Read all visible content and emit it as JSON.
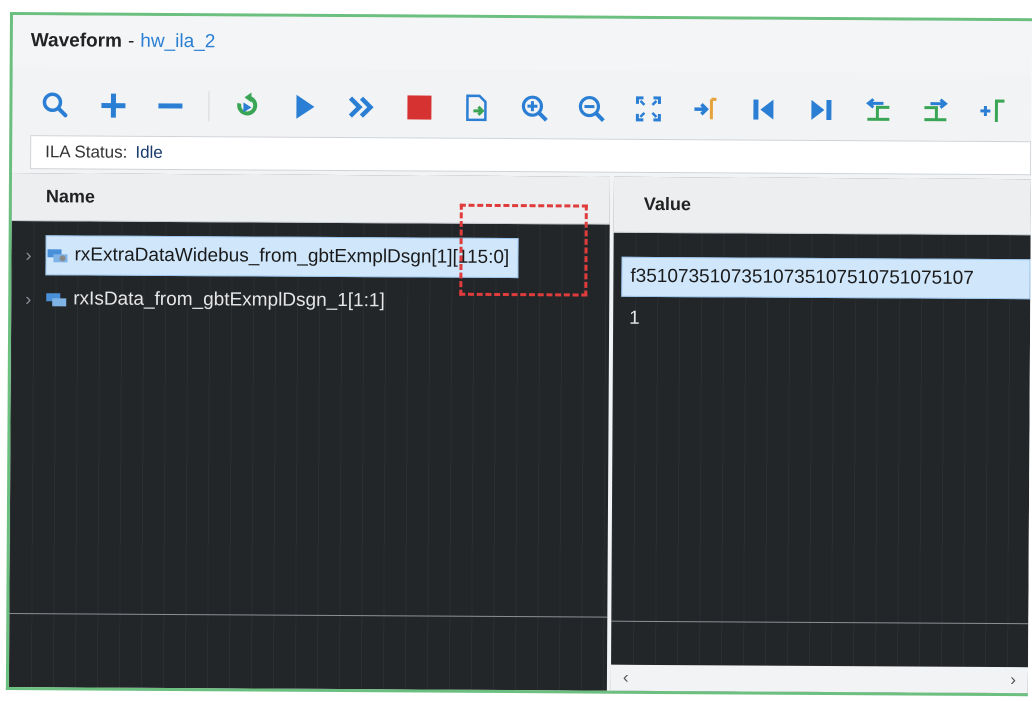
{
  "window": {
    "title_main": "Waveform",
    "title_sep": "-",
    "title_name": "hw_ila_2"
  },
  "toolbar": {
    "buttons": [
      {
        "icon": "search-icon"
      },
      {
        "icon": "plus-icon"
      },
      {
        "icon": "minus-icon"
      },
      {
        "icon": "run-trigger-immediate-icon"
      },
      {
        "icon": "play-icon"
      },
      {
        "icon": "fast-forward-icon"
      },
      {
        "icon": "stop-icon"
      },
      {
        "icon": "export-icon"
      },
      {
        "icon": "zoom-in-icon"
      },
      {
        "icon": "zoom-out-icon"
      },
      {
        "icon": "zoom-fit-icon"
      },
      {
        "icon": "go-to-cursor-icon"
      },
      {
        "icon": "go-to-start-icon"
      },
      {
        "icon": "go-to-end-icon"
      },
      {
        "icon": "previous-transition-icon"
      },
      {
        "icon": "next-transition-icon"
      },
      {
        "icon": "add-marker-icon"
      }
    ],
    "accent": "#2a7fd4",
    "stop_color": "#d63232",
    "green": "#3aa655"
  },
  "status": {
    "label": "ILA Status:",
    "value": "Idle"
  },
  "name_panel": {
    "header": "Name",
    "rows": [
      {
        "label": "rxExtraDataWidebus_from_gbtExmplDsgn[1][115:0]",
        "selected": true
      },
      {
        "label": "rxIsData_from_gbtExmplDsgn_1[1:1]",
        "selected": false
      }
    ]
  },
  "value_panel": {
    "header": "Value",
    "rows": [
      {
        "value": "f35107351073510735107510751075107",
        "selected": true
      },
      {
        "value": "1",
        "selected": false
      }
    ]
  },
  "scrollbar": {
    "left_arrow": "‹",
    "right_arrow": "›"
  },
  "colors": {
    "frame_border": "#6bbf7f",
    "panel_bg": "#232629",
    "selection": "#cfe6fb",
    "highlight_box": "#e03c3c"
  }
}
